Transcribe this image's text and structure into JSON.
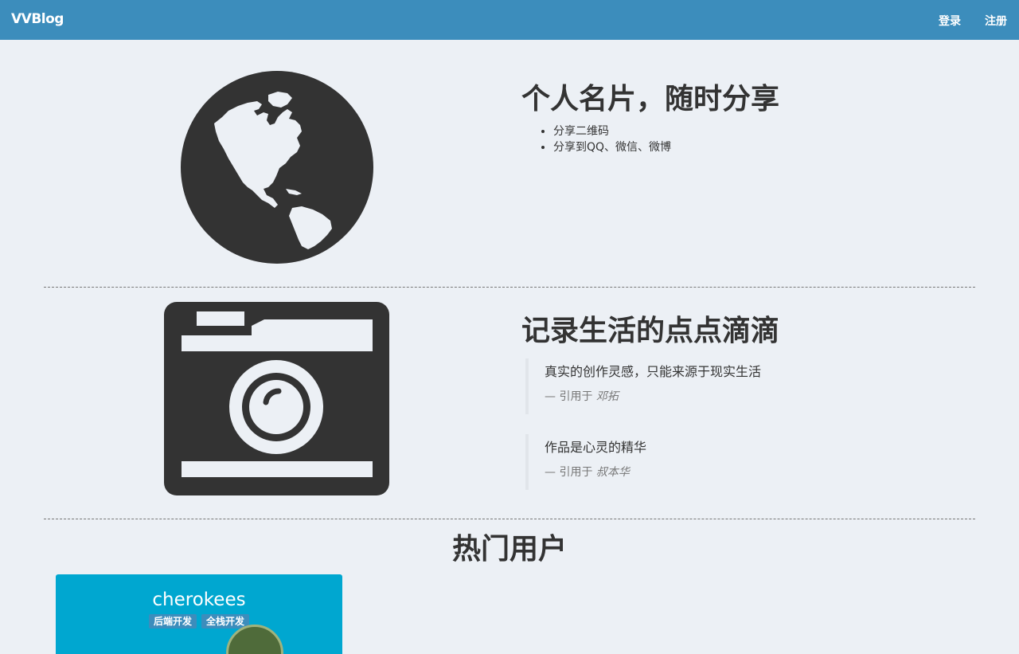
{
  "navbar": {
    "brand": "VVBlog",
    "login_label": "登录",
    "register_label": "注册",
    "background": "#3c8dbc"
  },
  "features": [
    {
      "icon": "globe-icon",
      "title": "个人名片，随时分享",
      "items": [
        "分享二维码",
        "分享到QQ、微信、微博"
      ]
    },
    {
      "icon": "camera-icon",
      "title": "记录生活的点点滴滴",
      "quotes": [
        {
          "text": "真实的创作灵感，只能来源于现实生活",
          "prefix": "— 引用于",
          "author": "邓拓"
        },
        {
          "text": "作品是心灵的精华",
          "prefix": "— 引用于",
          "author": "叔本华"
        }
      ]
    }
  ],
  "popular": {
    "title": "热门用户",
    "users": [
      {
        "name": "cherokees",
        "tags": [
          "后端开发",
          "全栈开发"
        ],
        "card_color": "#00a7d0"
      }
    ]
  }
}
